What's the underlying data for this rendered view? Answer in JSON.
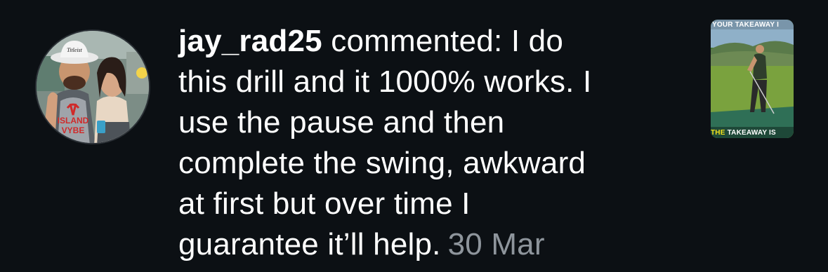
{
  "comment": {
    "username": "jay_rad25",
    "action_text": " commented: I do",
    "lines": [
      "this drill and it 1000% works. I",
      "use the pause and then",
      "complete the swing, awkward",
      "at first but over time I"
    ],
    "last_line": "guarantee it’ll help.",
    "timestamp": "30 Mar"
  },
  "avatar": {
    "icon": "profile-photo",
    "hat_logo": "Titleist",
    "shirt_text_1": "ISLAND",
    "shirt_text_2": "VYBE"
  },
  "post_thumbnail": {
    "icon": "post-thumbnail",
    "top_caption": "YOUR TAKEAWAY I",
    "bottom_caption_highlight": "THE",
    "bottom_caption_rest": " TAKEAWAY IS"
  },
  "colors": {
    "background": "#0c1014",
    "text": "#ffffff",
    "timestamp": "#8e959c",
    "caption_highlight": "#f2e21c"
  }
}
